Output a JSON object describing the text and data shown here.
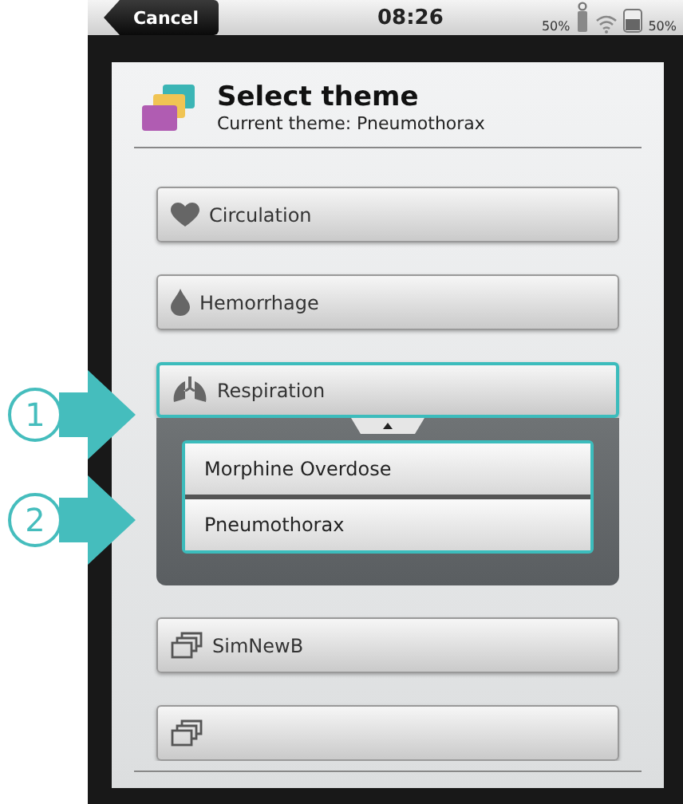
{
  "status_bar": {
    "back_label": "Cancel",
    "time": "08:26",
    "device_battery": "50%",
    "tablet_battery": "50%"
  },
  "dialog": {
    "title": "Select theme",
    "subtitle": "Current theme: Pneumothorax",
    "categories": [
      {
        "kind": "heart",
        "label": "Circulation",
        "expanded": false
      },
      {
        "kind": "drop",
        "label": "Hemorrhage",
        "expanded": false
      },
      {
        "kind": "lungs",
        "label": "Respiration",
        "expanded": true,
        "children": [
          {
            "label": "Morphine Overdose"
          },
          {
            "label": "Pneumothorax"
          }
        ]
      },
      {
        "kind": "folder",
        "label": "SimNewB",
        "expanded": false
      },
      {
        "kind": "folder",
        "expanded": false
      }
    ]
  },
  "callouts": [
    {
      "number": "1"
    },
    {
      "number": "2"
    }
  ]
}
